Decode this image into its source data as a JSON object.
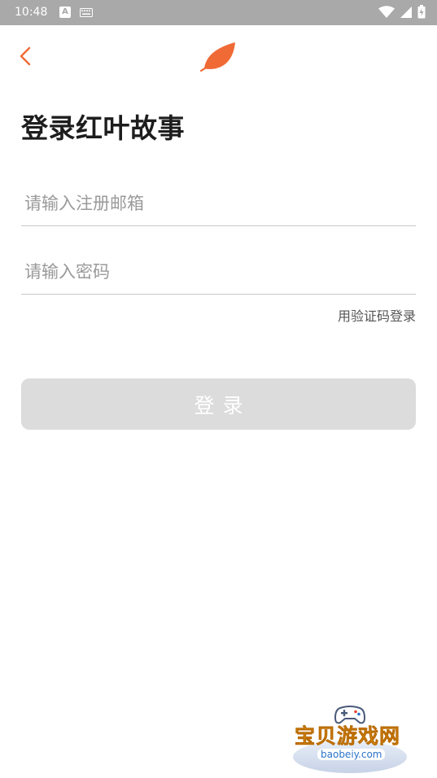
{
  "status_bar": {
    "time": "10:48",
    "a_badge": "A",
    "icons": [
      "keyboard-icon",
      "wifi-icon",
      "signal-icon",
      "battery-icon"
    ]
  },
  "header": {
    "back_icon": "chevron-left-icon",
    "logo_icon": "leaf-icon",
    "accent_color": "#f06a35"
  },
  "title": "登录红叶故事",
  "form": {
    "email_placeholder": "请输入注册邮箱",
    "email_value": "",
    "password_placeholder": "请输入密码",
    "password_value": "",
    "code_login_label": "用验证码登录",
    "login_button_label": "登录"
  },
  "watermark": {
    "text": "宝贝游戏网",
    "url": "baobeiy.com"
  }
}
